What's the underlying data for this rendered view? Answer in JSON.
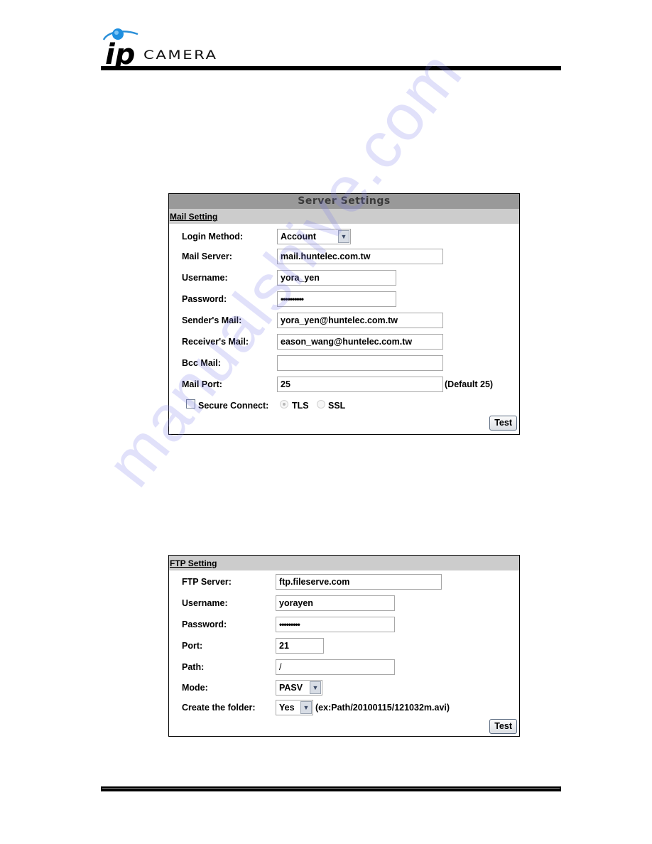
{
  "header": {
    "logo_ip": "ip",
    "logo_camera": "CAMERA"
  },
  "mail_panel": {
    "title": "Server Settings",
    "section": "Mail Setting",
    "fields": [
      {
        "label": "Login Method:",
        "type": "select",
        "value": "Account"
      },
      {
        "label": "Mail Server:",
        "type": "text",
        "value": "mail.huntelec.com.tw"
      },
      {
        "label": "Username:",
        "type": "text",
        "value": "yora_yen"
      },
      {
        "label": "Password:",
        "type": "password",
        "value": "••••••••••"
      },
      {
        "label": "Sender's Mail:",
        "type": "text",
        "value": "yora_yen@huntelec.com.tw"
      },
      {
        "label": "Receiver's Mail:",
        "type": "text",
        "value": "eason_wang@huntelec.com.tw"
      },
      {
        "label": "Bcc Mail:",
        "type": "text",
        "value": ""
      },
      {
        "label": "Mail Port:",
        "type": "text",
        "value": "25",
        "note": "(Default 25)"
      }
    ],
    "secure_connect": {
      "label": "Secure Connect:",
      "checked": false,
      "options": [
        "TLS",
        "SSL"
      ],
      "selected": "TLS"
    },
    "test_button": "Test"
  },
  "ftp_panel": {
    "section": "FTP Setting",
    "fields": [
      {
        "label": "FTP Server:",
        "type": "text",
        "value": "ftp.fileserve.com"
      },
      {
        "label": "Username:",
        "type": "text",
        "value": "yorayen"
      },
      {
        "label": "Password:",
        "type": "password",
        "value": "•••••••••"
      },
      {
        "label": "Port:",
        "type": "text",
        "value": "21"
      },
      {
        "label": "Path:",
        "type": "text",
        "value": "/"
      },
      {
        "label": "Mode:",
        "type": "select",
        "value": "PASV"
      },
      {
        "label": "Create the folder:",
        "type": "select",
        "value": "Yes",
        "note": "(ex:Path/20100115/121032m.avi)"
      }
    ],
    "test_button": "Test"
  },
  "watermark": "manualshive.com",
  "colors": {
    "title_bar": "#999999",
    "section_bar": "#cccccc",
    "logo_accent": "#1e8fe0"
  }
}
